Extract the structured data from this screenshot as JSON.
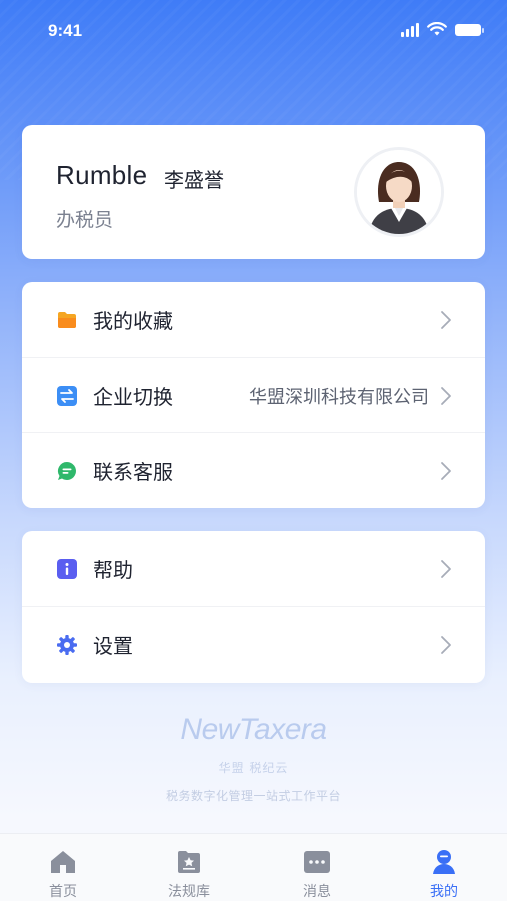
{
  "status_bar": {
    "time": "9:41"
  },
  "profile": {
    "name": "Rumble",
    "name_cn": "李盛誉",
    "role": "办税员"
  },
  "menu_group_1": [
    {
      "label": "我的收藏",
      "icon": "folder-icon",
      "value": ""
    },
    {
      "label": "企业切换",
      "icon": "switch-icon",
      "value": "华盟深圳科技有限公司"
    },
    {
      "label": "联系客服",
      "icon": "chat-icon",
      "value": ""
    }
  ],
  "menu_group_2": [
    {
      "label": "帮助",
      "icon": "info-icon"
    },
    {
      "label": "设置",
      "icon": "gear-icon"
    }
  ],
  "brand": {
    "logo": "NewTaxera",
    "sub": "华盟 税纪云",
    "tagline": "税务数字化管理一站式工作平台"
  },
  "tabs": [
    {
      "label": "首页",
      "icon": "home-icon"
    },
    {
      "label": "法规库",
      "icon": "regulation-icon"
    },
    {
      "label": "消息",
      "icon": "message-icon"
    },
    {
      "label": "我的",
      "icon": "profile-icon",
      "active": true
    }
  ],
  "colors": {
    "accent": "#3a6ff6",
    "folder": "#f5a623",
    "switch": "#3c8ef5",
    "chat": "#2fb86b",
    "info": "#5a5ef0",
    "gear": "#4a6cf0"
  }
}
